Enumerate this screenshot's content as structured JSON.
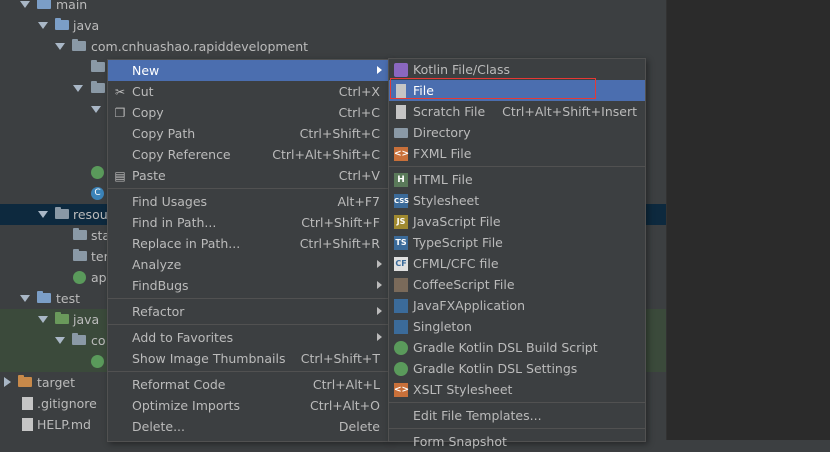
{
  "tree": {
    "main": "main",
    "java": "java",
    "package": "com.cnhuashao.rapiddevelopment",
    "resources": "resou",
    "static": "sta",
    "templates": "ter",
    "app": "ap",
    "test": "test",
    "test_java": "java",
    "test_com": "co",
    "target": "target",
    "gitignore": ".gitignore",
    "help": "HELP.md"
  },
  "menu1": {
    "items": [
      {
        "label": "New",
        "shortcut": "",
        "sub": true
      },
      {
        "label": "Cut",
        "shortcut": "Ctrl+X",
        "icon": "scissors-icon"
      },
      {
        "label": "Copy",
        "shortcut": "Ctrl+C",
        "icon": "copy-icon"
      },
      {
        "label": "Copy Path",
        "shortcut": "Ctrl+Shift+C"
      },
      {
        "label": "Copy Reference",
        "shortcut": "Ctrl+Alt+Shift+C"
      },
      {
        "label": "Paste",
        "shortcut": "Ctrl+V",
        "icon": "paste-icon"
      },
      {
        "label": "Find Usages",
        "shortcut": "Alt+F7"
      },
      {
        "label": "Find in Path...",
        "shortcut": "Ctrl+Shift+F"
      },
      {
        "label": "Replace in Path...",
        "shortcut": "Ctrl+Shift+R"
      },
      {
        "label": "Analyze",
        "shortcut": "",
        "sub": true
      },
      {
        "label": "FindBugs",
        "shortcut": "",
        "sub": true
      },
      {
        "label": "Refactor",
        "shortcut": "",
        "sub": true
      },
      {
        "label": "Add to Favorites",
        "shortcut": "",
        "sub": true
      },
      {
        "label": "Show Image Thumbnails",
        "shortcut": "Ctrl+Shift+T"
      },
      {
        "label": "Reformat Code",
        "shortcut": "Ctrl+Alt+L"
      },
      {
        "label": "Optimize Imports",
        "shortcut": "Ctrl+Alt+O"
      },
      {
        "label": "Delete...",
        "shortcut": "Delete"
      }
    ]
  },
  "menu2": {
    "items": [
      {
        "label": "Kotlin File/Class",
        "shortcut": ""
      },
      {
        "label": "File",
        "shortcut": ""
      },
      {
        "label": "Scratch File",
        "shortcut": "Ctrl+Alt+Shift+Insert"
      },
      {
        "label": "Directory",
        "shortcut": ""
      },
      {
        "label": "FXML File",
        "shortcut": ""
      },
      {
        "label": "HTML File",
        "shortcut": ""
      },
      {
        "label": "Stylesheet",
        "shortcut": ""
      },
      {
        "label": "JavaScript File",
        "shortcut": ""
      },
      {
        "label": "TypeScript File",
        "shortcut": ""
      },
      {
        "label": "CFML/CFC file",
        "shortcut": ""
      },
      {
        "label": "CoffeeScript File",
        "shortcut": ""
      },
      {
        "label": "JavaFXApplication",
        "shortcut": ""
      },
      {
        "label": "Singleton",
        "shortcut": ""
      },
      {
        "label": "Gradle Kotlin DSL Build Script",
        "shortcut": ""
      },
      {
        "label": "Gradle Kotlin DSL Settings",
        "shortcut": ""
      },
      {
        "label": "XSLT Stylesheet",
        "shortcut": ""
      },
      {
        "label": "Edit File Templates...",
        "shortcut": ""
      },
      {
        "label": "Form Snapshot",
        "shortcut": ""
      }
    ],
    "icon_labels": {
      "html": "H",
      "css": "CSS",
      "js": "JS",
      "ts": "TS",
      "cf": "CF",
      "fx": "<>",
      "xslt": "<>"
    }
  },
  "colors": {
    "highlight": "#4b6eaf",
    "background": "#3c3f41",
    "editor": "#2b2b2b",
    "red_outline": "#e53935"
  }
}
